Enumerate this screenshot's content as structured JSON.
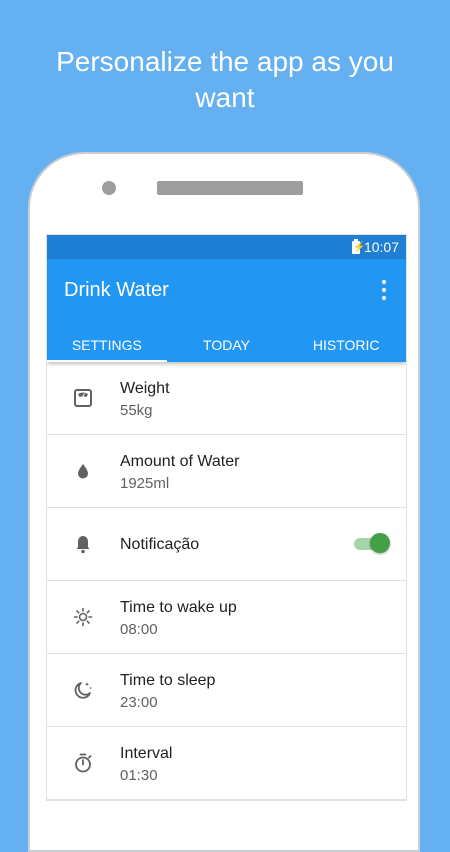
{
  "headline": {
    "line1": "Personalize the app as you",
    "line2": "want"
  },
  "colors": {
    "background": "#64b0f1",
    "status_bar": "#1f7fd4",
    "app_bar": "#2196f3",
    "toggle_on": "#43a047"
  },
  "status_bar": {
    "time": "10:07",
    "battery_icon": "battery-charging-icon"
  },
  "app_bar": {
    "title": "Drink Water",
    "menu_icon": "more-vert-icon"
  },
  "tabs": [
    {
      "label": "SETTINGS",
      "active": true
    },
    {
      "label": "TODAY",
      "active": false
    },
    {
      "label": "HISTORIC",
      "active": false
    }
  ],
  "settings": [
    {
      "icon": "scale-icon",
      "label": "Weight",
      "value": "55kg"
    },
    {
      "icon": "water-drop-icon",
      "label": "Amount of Water",
      "value": "1925ml"
    },
    {
      "icon": "bell-icon",
      "label": "Notificação",
      "toggle": true
    },
    {
      "icon": "sun-icon",
      "label": "Time to wake up",
      "value": "08:00"
    },
    {
      "icon": "moon-icon",
      "label": "Time to sleep",
      "value": "23:00"
    },
    {
      "icon": "timer-icon",
      "label": "Interval",
      "value": "01:30"
    }
  ]
}
